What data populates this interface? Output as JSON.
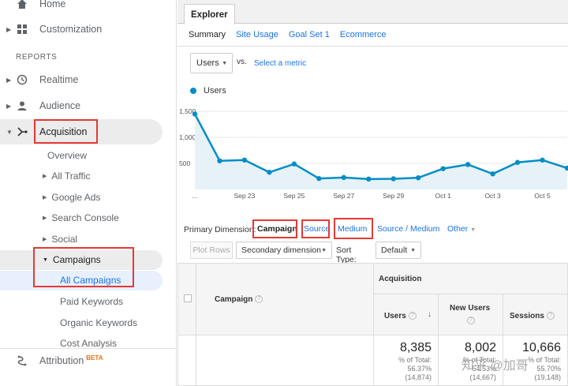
{
  "sidebar": {
    "home_label": "Home",
    "customization_label": "Customization",
    "reports_label": "REPORTS",
    "realtime_label": "Realtime",
    "audience_label": "Audience",
    "acquisition_label": "Acquisition",
    "overview_label": "Overview",
    "all_traffic_label": "All Traffic",
    "google_ads_label": "Google Ads",
    "search_console_label": "Search Console",
    "social_label": "Social",
    "campaigns_label": "Campaigns",
    "all_campaigns_label": "All Campaigns",
    "paid_keywords_label": "Paid Keywords",
    "organic_keywords_label": "Organic Keywords",
    "cost_analysis_label": "Cost Analysis",
    "attribution_label": "Attribution",
    "beta_label": "BETA"
  },
  "main": {
    "tab_label": "Explorer",
    "subtabs": [
      "Summary",
      "Site Usage",
      "Goal Set 1",
      "Ecommerce"
    ],
    "metric_select": "Users",
    "vs_label": "vs.",
    "select_metric_label": "Select a metric",
    "legend_label": "Users",
    "primary_dimension_label": "Primary Dimension:",
    "dimensions": [
      "Campaign",
      "Source",
      "Medium",
      "Source / Medium",
      "Other"
    ],
    "plot_rows_label": "Plot Rows",
    "secondary_dimension_label": "Secondary dimension",
    "sort_type_label": "Sort Type:",
    "sort_type_value": "Default",
    "table": {
      "campaign_header": "Campaign",
      "acquisition_header": "Acquisition",
      "users_header": "Users",
      "new_users_header": "New Users",
      "sessions_header": "Sessions",
      "users_total": "8,385",
      "users_pct_label": "% of Total:",
      "users_pct": "56.37%",
      "users_of": "(14,874)",
      "new_users_total": "8,002",
      "new_users_pct_label": "% of Total:",
      "new_users_pct": "54.53%",
      "new_users_of": "(14,667)",
      "sessions_total": "10,666",
      "sessions_pct_label": "% of Total:",
      "sessions_pct": "55.70%",
      "sessions_of": "(19,148)"
    }
  },
  "watermark": "知乎 @加哥",
  "chart_data": {
    "type": "area",
    "title": "",
    "series": [
      {
        "name": "Users",
        "values": [
          1450,
          550,
          565,
          330,
          490,
          210,
          230,
          200,
          205,
          225,
          400,
          480,
          300,
          520,
          565,
          410
        ]
      }
    ],
    "x": [
      "Sep 21",
      "Sep 22",
      "Sep 23",
      "Sep 24",
      "Sep 25",
      "Sep 26",
      "Sep 27",
      "Sep 28",
      "Sep 29",
      "Sep 30",
      "Oct 1",
      "Oct 2",
      "Oct 3",
      "Oct 4",
      "Oct 5",
      "Oct 6"
    ],
    "x_tick_labels": [
      "...",
      "Sep 23",
      "Sep 25",
      "Sep 27",
      "Sep 29",
      "Oct 1",
      "Oct 3",
      "Oct 5"
    ],
    "y_tick_labels": [
      "1,500",
      "1,000",
      "500"
    ],
    "ylim": [
      0,
      1700
    ],
    "color": "#058dc7",
    "fill": "#e6f2f8",
    "grid": true
  }
}
